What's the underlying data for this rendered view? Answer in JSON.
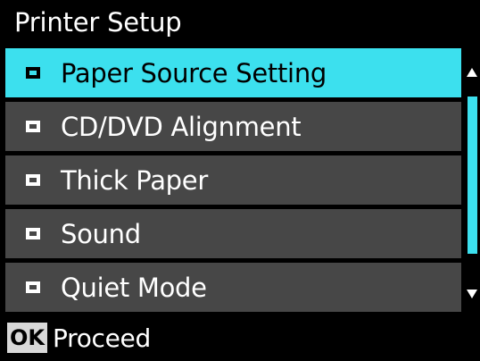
{
  "header": {
    "title": "Printer Setup"
  },
  "menu": {
    "items": [
      {
        "label": "Paper Source Setting",
        "selected": true
      },
      {
        "label": "CD/DVD Alignment",
        "selected": false
      },
      {
        "label": "Thick Paper",
        "selected": false
      },
      {
        "label": "Sound",
        "selected": false
      },
      {
        "label": "Quiet Mode",
        "selected": false
      }
    ]
  },
  "scrollbar": {
    "up_icon": "arrow-up-icon",
    "down_icon": "arrow-down-icon"
  },
  "footer": {
    "ok_key": "OK",
    "action_label": "Proceed"
  },
  "colors": {
    "highlight": "#3ce0ee",
    "item_bg": "#474747",
    "background": "#000000"
  }
}
